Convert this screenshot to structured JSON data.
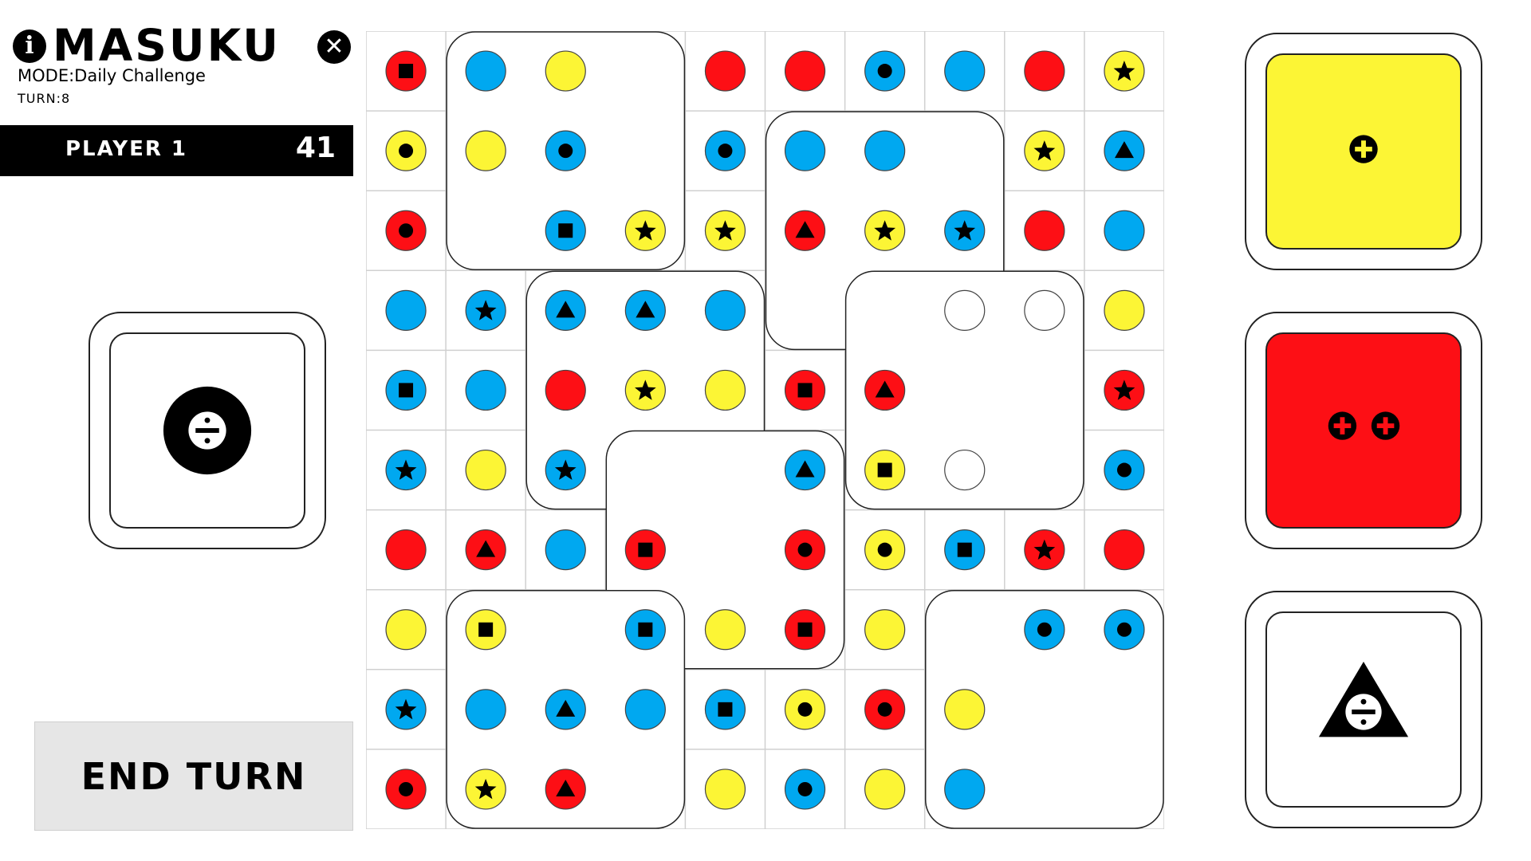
{
  "header": {
    "title": "MASUKU",
    "mode": "MODE:Daily Challenge",
    "turn": "TURN:8",
    "info_icon": "i",
    "close_icon": "✕"
  },
  "player": {
    "name": "PLAYER 1",
    "score": "41"
  },
  "end_turn_label": "END TURN",
  "left_tile": {
    "color": "white",
    "symbol": "divide-in-circle-icon"
  },
  "right_tiles": [
    {
      "color": "yellow",
      "symbol": "plus-icon",
      "count": 1
    },
    {
      "color": "red",
      "symbol": "plus-icon",
      "count": 2
    },
    {
      "color": "white",
      "symbol": "divide-in-triangle-icon"
    }
  ],
  "colors": {
    "red": "#fd0f15",
    "blue": "#00a8f0",
    "yellow": "#fcf535",
    "white": "#ffffff",
    "grid": "#d0d0d0",
    "black": "#000000"
  },
  "board": {
    "rows": 10,
    "cols": 10,
    "cells": [
      [
        "r:sq",
        "b",
        "y",
        "",
        "r",
        "r",
        "b:ci",
        "b",
        "r",
        "y:st"
      ],
      [
        "y:ci",
        "y",
        "b:ci",
        "",
        "b:ci",
        "b",
        "b",
        "",
        "y:st",
        "b:tr"
      ],
      [
        "r:ci",
        "",
        "b:sq",
        "y:st",
        "y:st",
        "r:tr",
        "y:st",
        "b:st",
        "r",
        "b"
      ],
      [
        "b",
        "b:st",
        "b:tr",
        "b:tr",
        "b",
        "",
        "",
        "w",
        "w",
        "y"
      ],
      [
        "b:sq",
        "b",
        "r",
        "y:st",
        "y",
        "r:sq",
        "r:tr",
        "",
        "",
        "r:st"
      ],
      [
        "b:st",
        "y",
        "b:st",
        "",
        "",
        "b:tr",
        "y:sq",
        "w",
        "",
        "b:ci"
      ],
      [
        "r",
        "r:tr",
        "b",
        "r:sq",
        "",
        "r:ci",
        "y:ci",
        "b:sq",
        "r:st",
        "r"
      ],
      [
        "y",
        "y:sq",
        "",
        "b:sq",
        "y",
        "r:sq",
        "y",
        "",
        "b:ci",
        "b:ci"
      ],
      [
        "b:st",
        "b",
        "b:tr",
        "b",
        "b:sq",
        "y:ci",
        "r:ci",
        "y",
        "",
        ""
      ],
      [
        "r:ci",
        "y:st",
        "r:tr",
        "",
        "y",
        "b:ci",
        "y",
        "b",
        "",
        ""
      ]
    ],
    "cards": [
      {
        "col": 1,
        "row": 0,
        "w": 3,
        "h": 3
      },
      {
        "col": 5,
        "row": 1,
        "w": 3,
        "h": 3
      },
      {
        "col": 2,
        "row": 3,
        "w": 3,
        "h": 3
      },
      {
        "col": 6,
        "row": 3,
        "w": 3,
        "h": 3
      },
      {
        "col": 3,
        "row": 5,
        "w": 3,
        "h": 3
      },
      {
        "col": 1,
        "row": 7,
        "w": 3,
        "h": 3
      },
      {
        "col": 7,
        "row": 7,
        "w": 3,
        "h": 3
      }
    ]
  }
}
